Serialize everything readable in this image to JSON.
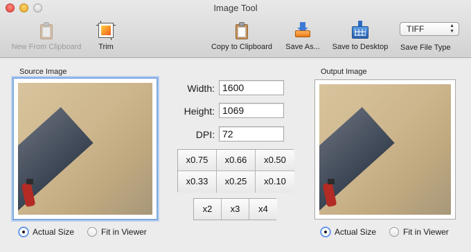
{
  "window": {
    "title": "Image Tool"
  },
  "toolbar": {
    "new_from_clipboard": "New From Clipboard",
    "trim": "Trim",
    "copy_to_clipboard": "Copy to Clipboard",
    "save_as": "Save As...",
    "save_to_desktop": "Save to Desktop",
    "save_file_type": "Save File Type",
    "file_type_value": "TIFF",
    "file_type_options": [
      "TIFF"
    ]
  },
  "source": {
    "title": "Source Image",
    "actual_size": "Actual Size",
    "fit_in_viewer": "Fit in Viewer",
    "selected": "Actual Size"
  },
  "output": {
    "title": "Output Image",
    "actual_size": "Actual Size",
    "fit_in_viewer": "Fit in Viewer",
    "selected": "Actual Size"
  },
  "fields": {
    "width_label": "Width:",
    "width_value": "1600",
    "height_label": "Height:",
    "height_value": "1069",
    "dpi_label": "DPI:",
    "dpi_value": "72"
  },
  "scale_buttons": [
    "x0.75",
    "x0.66",
    "x0.50",
    "x0.33",
    "x0.25",
    "x0.10"
  ],
  "multiply_buttons": [
    "x2",
    "x3",
    "x4"
  ],
  "icons": {
    "new_from_clipboard": "clipboard-icon",
    "trim": "trim-icon",
    "copy_to_clipboard": "clipboard-icon",
    "save_as": "save-tray-icon",
    "save_to_desktop": "desktop-icon"
  }
}
